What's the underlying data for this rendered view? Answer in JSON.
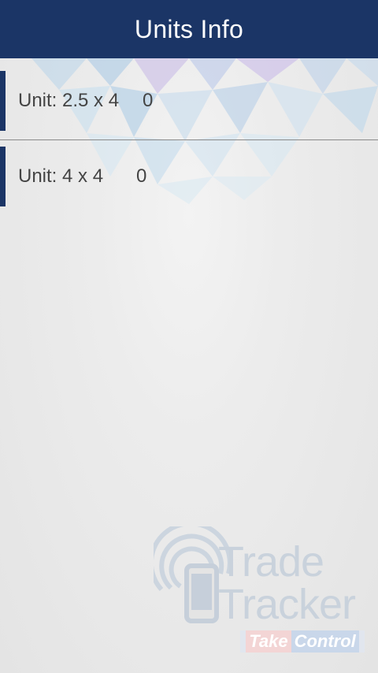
{
  "header": {
    "title": "Units Info"
  },
  "units": [
    {
      "label": "Unit: 2.5 x 4",
      "value": "0"
    },
    {
      "label": "Unit: 4 x 4",
      "value": "0"
    }
  ],
  "watermark": {
    "line1": "Trade",
    "line2": "Tracker",
    "tagline_take": "Take",
    "tagline_control": "Control"
  },
  "colors": {
    "header": "#1b3566",
    "accent_bar": "#1b3566"
  }
}
